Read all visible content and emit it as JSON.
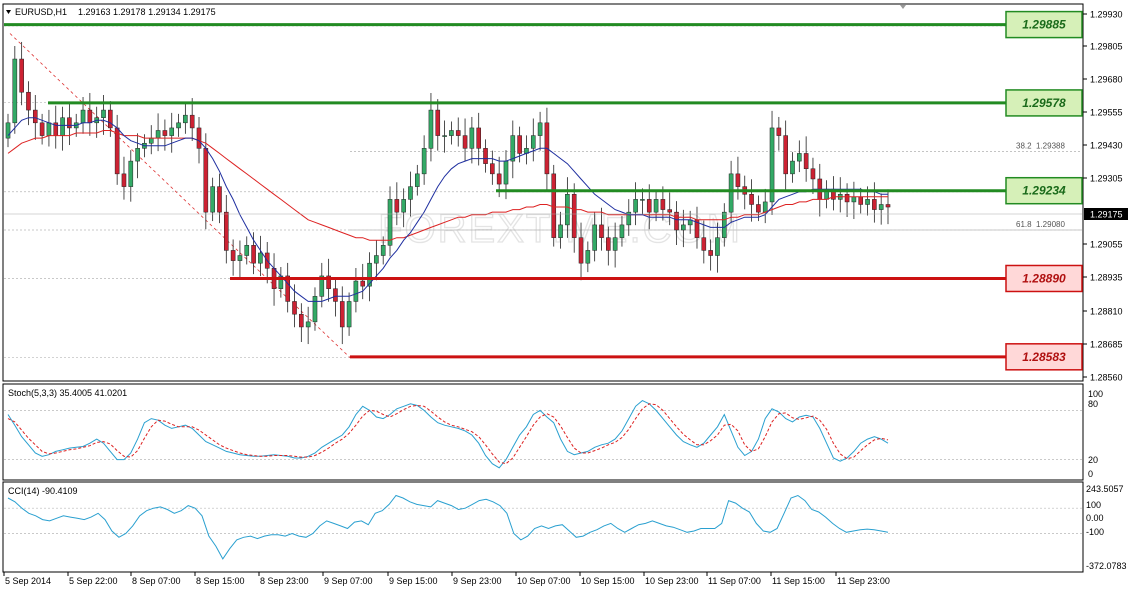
{
  "header": {
    "symbol": "EURUSD,H1",
    "ohlc": "1.29163 1.29178 1.29134 1.29175"
  },
  "colors": {
    "bull": "#33aa66",
    "bear": "#cc2233",
    "ma_fast": "#1f2fa0",
    "ma_slow": "#dd2222",
    "resistance": "#228b22",
    "support": "#cc1111",
    "stoch_main": "#2aa0d0",
    "stoch_signal": "#dd2222",
    "cci": "#2aa0d0",
    "label_green_bg": "#d6f0b8",
    "label_red_bg": "#ffd8d8"
  },
  "watermark": "FOREXTIME.COM",
  "chart_data": [
    {
      "type": "candlestick",
      "name": "EURUSD,H1",
      "ylim": [
        1.285,
        1.2995
      ],
      "y_ticks": [
        "1.29930",
        "1.29805",
        "1.29680",
        "1.29555",
        "1.29430",
        "1.29305",
        "1.29175",
        "1.29055",
        "1.28935",
        "1.28810",
        "1.28685",
        "1.28560"
      ],
      "current_price": "1.29175",
      "x_ticks": [
        "5 Sep 2014",
        "5 Sep 22:00",
        "8 Sep 07:00",
        "8 Sep 15:00",
        "8 Sep 23:00",
        "9 Sep 07:00",
        "9 Sep 15:00",
        "9 Sep 23:00",
        "10 Sep 07:00",
        "10 Sep 15:00",
        "10 Sep 23:00",
        "11 Sep 07:00",
        "11 Sep 15:00",
        "11 Sep 23:00"
      ],
      "levels": [
        {
          "value": "1.29885",
          "kind": "resistance"
        },
        {
          "value": "1.29578",
          "kind": "resistance"
        },
        {
          "value": "1.29234",
          "kind": "resistance"
        },
        {
          "value": "1.28890",
          "kind": "support"
        },
        {
          "value": "1.28583",
          "kind": "support"
        }
      ],
      "fibonacci": [
        {
          "ratio": "38.2",
          "price": "1.29388"
        },
        {
          "ratio": "61.8",
          "price": "1.29080"
        }
      ],
      "close": [
        1.295,
        1.2975,
        1.2962,
        1.2955,
        1.295,
        1.2945,
        1.295,
        1.2945,
        1.2952,
        1.2948,
        1.295,
        1.2955,
        1.295,
        1.2952,
        1.2955,
        1.2948,
        1.293,
        1.2925,
        1.2935,
        1.294,
        1.2942,
        1.2944,
        1.2947,
        1.2945,
        1.2948,
        1.295,
        1.2953,
        1.2948,
        1.294,
        1.2915,
        1.2925,
        1.2915,
        1.29,
        1.2896,
        1.2898,
        1.2902,
        1.2895,
        1.2899,
        1.2893,
        1.2885,
        1.289,
        1.288,
        1.2875,
        1.287,
        1.2872,
        1.2882,
        1.289,
        1.2885,
        1.288,
        1.287,
        1.288,
        1.2888,
        1.2886,
        1.2895,
        1.2898,
        1.2902,
        1.292,
        1.2915,
        1.292,
        1.2925,
        1.293,
        1.294,
        1.2955,
        1.2945,
        1.2945,
        1.2947,
        1.2945,
        1.294,
        1.2948,
        1.294,
        1.2934,
        1.293,
        1.2926,
        1.2935,
        1.2945,
        1.2938,
        1.294,
        1.2945,
        1.295,
        1.293,
        1.2905,
        1.291,
        1.2922,
        1.2905,
        1.2895,
        1.29,
        1.291,
        1.2905,
        1.29,
        1.2905,
        1.291,
        1.2915,
        1.292,
        1.292,
        1.2915,
        1.292,
        1.2916,
        1.2915,
        1.2908,
        1.291,
        1.2912,
        1.2905,
        1.29,
        1.2898,
        1.2905,
        1.2915,
        1.293,
        1.2925,
        1.2922,
        1.2918,
        1.2915,
        1.2919,
        1.2948,
        1.2945,
        1.293,
        1.2935,
        1.2938,
        1.2932,
        1.2928,
        1.292,
        1.2924,
        1.292,
        1.2922,
        1.2919,
        1.2921,
        1.2918,
        1.292,
        1.2916,
        1.2918,
        1.2917
      ],
      "ma_fast": [
        1.2945,
        1.2948,
        1.2951,
        1.2952,
        1.2952,
        1.2951,
        1.295,
        1.2949,
        1.2949,
        1.2949,
        1.2949,
        1.295,
        1.295,
        1.2951,
        1.2951,
        1.295,
        1.2948,
        1.2945,
        1.2943,
        1.2942,
        1.2941,
        1.2941,
        1.2941,
        1.2941,
        1.2942,
        1.2943,
        1.2944,
        1.2944,
        1.2943,
        1.294,
        1.2936,
        1.2931,
        1.2925,
        1.292,
        1.2914,
        1.2909,
        1.2904,
        1.29,
        1.2896,
        1.2893,
        1.289,
        1.2887,
        1.2884,
        1.2882,
        1.288,
        1.288,
        1.288,
        1.2881,
        1.2882,
        1.2882,
        1.2882,
        1.2883,
        1.2884,
        1.2887,
        1.289,
        1.2893,
        1.2897,
        1.29,
        1.2904,
        1.2907,
        1.2911,
        1.2915,
        1.292,
        1.2925,
        1.2929,
        1.2932,
        1.2934,
        1.2935,
        1.2936,
        1.2936,
        1.2936,
        1.2936,
        1.2935,
        1.2935,
        1.2936,
        1.2937,
        1.2938,
        1.2939,
        1.294,
        1.294,
        1.2938,
        1.2936,
        1.2934,
        1.2931,
        1.2928,
        1.2925,
        1.2922,
        1.292,
        1.2918,
        1.2916,
        1.2915,
        1.2914,
        1.2914,
        1.2914,
        1.2913,
        1.2913,
        1.2913,
        1.2913,
        1.2912,
        1.2912,
        1.2912,
        1.2911,
        1.291,
        1.2909,
        1.2909,
        1.2909,
        1.2911,
        1.2912,
        1.2913,
        1.2913,
        1.2913,
        1.2914,
        1.2917,
        1.292,
        1.2921,
        1.2922,
        1.2923,
        1.2923,
        1.2924,
        1.2924,
        1.2924,
        1.2924,
        1.2924,
        1.2924,
        1.2924,
        1.2924,
        1.2923,
        1.2923,
        1.2922,
        1.2922
      ],
      "ma_slow": [
        1.2938,
        1.294,
        1.2942,
        1.2943,
        1.2944,
        1.2944,
        1.2945,
        1.2945,
        1.2945,
        1.2945,
        1.2946,
        1.2946,
        1.2946,
        1.2946,
        1.2947,
        1.2947,
        1.2946,
        1.2945,
        1.2945,
        1.2945,
        1.2944,
        1.2944,
        1.2944,
        1.2944,
        1.2944,
        1.2944,
        1.2944,
        1.2944,
        1.2943,
        1.2942,
        1.294,
        1.2938,
        1.2936,
        1.2934,
        1.2932,
        1.293,
        1.2928,
        1.2926,
        1.2924,
        1.2922,
        1.292,
        1.2918,
        1.2916,
        1.2914,
        1.2912,
        1.2911,
        1.291,
        1.2909,
        1.2908,
        1.2907,
        1.2906,
        1.2905,
        1.2905,
        1.2904,
        1.2904,
        1.2904,
        1.2904,
        1.2905,
        1.2905,
        1.2906,
        1.2907,
        1.2908,
        1.2909,
        1.291,
        1.2911,
        1.2912,
        1.2913,
        1.2913,
        1.2914,
        1.2914,
        1.2914,
        1.2915,
        1.2915,
        1.2915,
        1.2916,
        1.2916,
        1.2917,
        1.2917,
        1.2918,
        1.2918,
        1.2917,
        1.2917,
        1.2917,
        1.2916,
        1.2916,
        1.2915,
        1.2915,
        1.2915,
        1.2914,
        1.2914,
        1.2914,
        1.2914,
        1.2914,
        1.2914,
        1.2914,
        1.2914,
        1.2914,
        1.2914,
        1.2913,
        1.2913,
        1.2913,
        1.2912,
        1.2912,
        1.2912,
        1.2912,
        1.2912,
        1.2913,
        1.2913,
        1.2914,
        1.2914,
        1.2914,
        1.2915,
        1.2916,
        1.2917,
        1.2918,
        1.2918,
        1.2919,
        1.2919,
        1.292,
        1.292,
        1.292,
        1.2921,
        1.2921,
        1.2921,
        1.2921,
        1.2921,
        1.2921,
        1.2921,
        1.2921,
        1.2921
      ]
    },
    {
      "type": "line",
      "name": "Stoch(5,3,3)",
      "header": "Stoch(5,3,3) 35.4005 41.0201",
      "ylim": [
        0,
        100
      ],
      "y_ticks": [
        "100",
        "80",
        "20",
        "0"
      ],
      "series": [
        {
          "name": "main",
          "values": [
            75,
            62,
            48,
            38,
            28,
            24,
            26,
            30,
            32,
            34,
            35,
            36,
            40,
            45,
            40,
            30,
            20,
            20,
            28,
            45,
            65,
            70,
            68,
            62,
            58,
            60,
            62,
            58,
            50,
            42,
            38,
            34,
            30,
            28,
            26,
            25,
            24,
            24,
            25,
            26,
            25,
            24,
            22,
            22,
            24,
            28,
            35,
            40,
            45,
            50,
            60,
            75,
            85,
            80,
            72,
            70,
            75,
            82,
            85,
            88,
            86,
            80,
            72,
            65,
            62,
            60,
            58,
            55,
            50,
            40,
            25,
            15,
            10,
            20,
            35,
            50,
            60,
            75,
            80,
            72,
            65,
            45,
            30,
            26,
            28,
            30,
            35,
            38,
            40,
            45,
            55,
            70,
            85,
            92,
            88,
            80,
            70,
            60,
            50,
            42,
            38,
            35,
            40,
            50,
            60,
            75,
            55,
            35,
            25,
            30,
            45,
            70,
            82,
            78,
            70,
            66,
            72,
            74,
            72,
            58,
            40,
            22,
            18,
            22,
            30,
            40,
            45,
            48,
            45,
            40
          ]
        },
        {
          "name": "signal",
          "values": [
            70,
            66,
            56,
            46,
            38,
            30,
            27,
            28,
            30,
            32,
            33,
            35,
            37,
            41,
            42,
            39,
            31,
            24,
            23,
            31,
            46,
            60,
            68,
            67,
            63,
            60,
            60,
            60,
            56,
            50,
            44,
            38,
            34,
            31,
            28,
            26,
            25,
            24,
            24,
            25,
            25,
            25,
            24,
            23,
            23,
            25,
            29,
            34,
            40,
            45,
            52,
            62,
            73,
            80,
            79,
            75,
            72,
            76,
            81,
            85,
            86,
            85,
            79,
            72,
            66,
            62,
            60,
            57,
            54,
            48,
            38,
            27,
            17,
            15,
            22,
            35,
            48,
            62,
            72,
            76,
            72,
            61,
            47,
            34,
            28,
            28,
            31,
            34,
            38,
            41,
            47,
            57,
            70,
            82,
            88,
            87,
            80,
            70,
            60,
            51,
            44,
            38,
            38,
            43,
            50,
            62,
            63,
            55,
            38,
            30,
            33,
            48,
            66,
            76,
            77,
            71,
            69,
            71,
            73,
            68,
            57,
            40,
            27,
            21,
            23,
            31,
            38,
            44,
            46,
            44
          ]
        }
      ]
    },
    {
      "type": "line",
      "name": "CCI(14)",
      "header": "CCI(14) -90.4109",
      "ylim": [
        -372.0783,
        243.5057
      ],
      "y_ticks": [
        "243.5057",
        "100",
        "0.00",
        "-100",
        "-372.0783"
      ],
      "series": [
        {
          "name": "CCI",
          "values": [
            180,
            150,
            100,
            60,
            40,
            10,
            0,
            20,
            40,
            30,
            20,
            10,
            30,
            60,
            10,
            -80,
            -130,
            -100,
            -40,
            40,
            80,
            100,
            110,
            90,
            60,
            80,
            120,
            100,
            40,
            -120,
            -200,
            -300,
            -220,
            -150,
            -130,
            -120,
            -140,
            -120,
            -110,
            -110,
            -120,
            -100,
            -120,
            -130,
            -100,
            -40,
            0,
            -20,
            -40,
            -60,
            -10,
            0,
            -30,
            60,
            80,
            130,
            200,
            180,
            150,
            130,
            120,
            110,
            160,
            140,
            120,
            90,
            100,
            130,
            160,
            170,
            150,
            120,
            60,
            -100,
            -150,
            -120,
            -60,
            -40,
            -60,
            -40,
            -30,
            -80,
            -130,
            -120,
            -90,
            -70,
            -40,
            -20,
            -60,
            -90,
            -60,
            -30,
            -20,
            0,
            -20,
            -40,
            -50,
            -70,
            -90,
            -80,
            -60,
            -60,
            -60,
            -20,
            160,
            140,
            100,
            70,
            -20,
            -80,
            -90,
            -60,
            60,
            180,
            200,
            160,
            90,
            70,
            30,
            -20,
            -60,
            -90,
            -80,
            -70,
            -65,
            -70,
            -80,
            -90
          ]
        }
      ]
    }
  ]
}
